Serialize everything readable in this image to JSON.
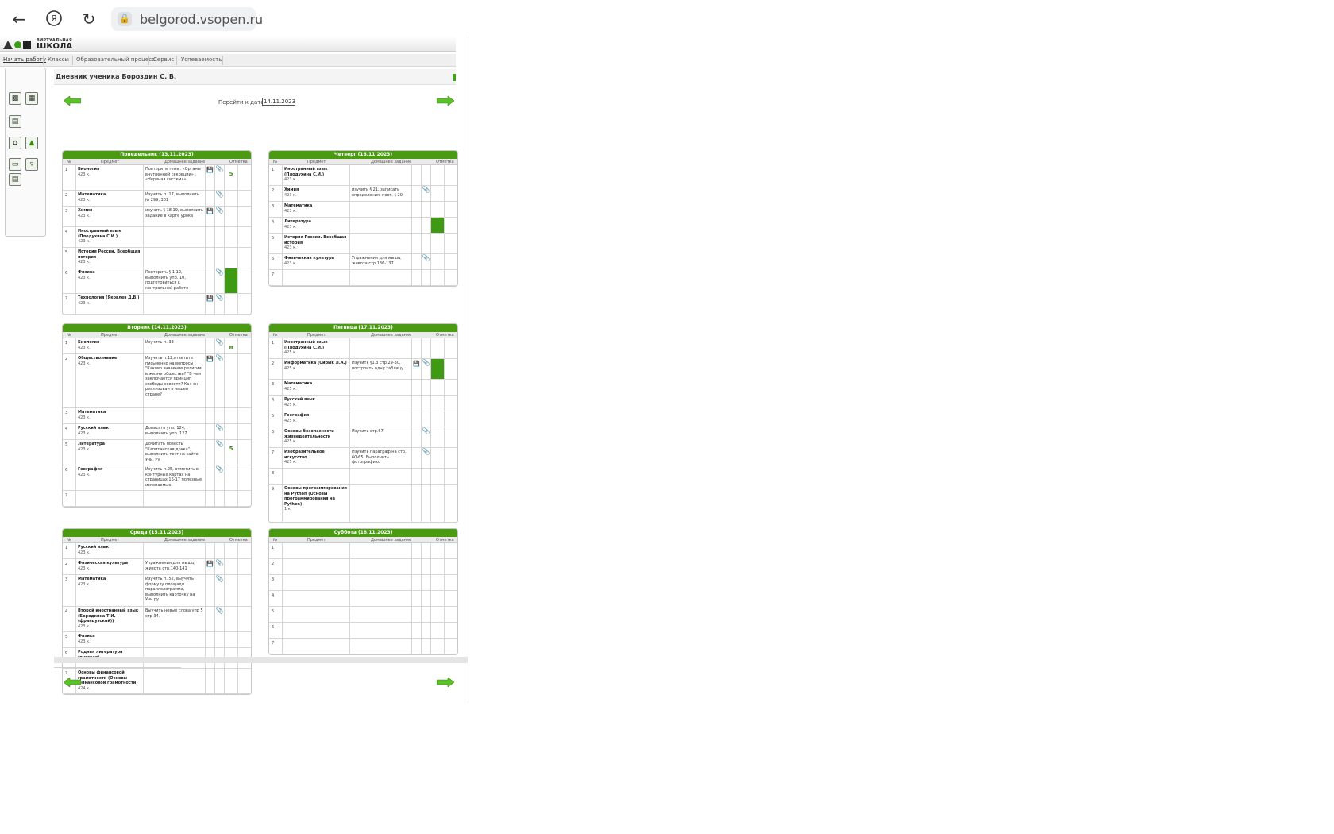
{
  "browser": {
    "url": "belgorod.vsopen.ru"
  },
  "site": {
    "logo_small": "ВИРТУАЛЬНАЯ",
    "logo_big": "ШКОЛА",
    "menu": [
      "Начать работу",
      "Классы",
      "Образовательный процесс",
      "Сервис",
      "Успеваемость"
    ],
    "page_title": "Дневник ученика Бороздин С. В.",
    "date_label": "Перейти к дате:",
    "date_value": "14.11.2023"
  },
  "columns": {
    "num": "№",
    "subject": "Предмет",
    "homework": "Домашнее задание",
    "mark": "Отметка"
  },
  "days": [
    {
      "title": "Понедельник (13.11.2023)",
      "rows": [
        {
          "n": "1",
          "subject": "Биология",
          "room": "423 к.",
          "hw": "Повторить темы: «Органы внутренней секреции» , «Нервная система»",
          "save": true,
          "clip": true,
          "mark": "5",
          "green": false
        },
        {
          "n": "2",
          "subject": "Математика",
          "room": "423 к.",
          "hw": "Изучить п. 17, выполнить № 299, 301",
          "save": false,
          "clip": true,
          "mark": "",
          "green": false
        },
        {
          "n": "3",
          "subject": "Химия",
          "room": "423 к.",
          "hw": "изучить § 18,19, выполнить задание в карте урока",
          "save": true,
          "clip": true,
          "mark": "",
          "green": false
        },
        {
          "n": "4",
          "subject": "Иностранный язык (Плодухина С.И.)",
          "room": "423 к.",
          "hw": "",
          "save": false,
          "clip": false,
          "mark": "",
          "green": false
        },
        {
          "n": "5",
          "subject": "История России. Всеобщая история",
          "room": "423 к.",
          "hw": "",
          "save": false,
          "clip": false,
          "mark": "",
          "green": false
        },
        {
          "n": "6",
          "subject": "Физика",
          "room": "423 к.",
          "hw": "Повторить § 1-12, выполнить упр. 10, подготовиться к контрольной работе",
          "save": false,
          "clip": true,
          "mark": "",
          "green": true
        },
        {
          "n": "7",
          "subject": "Технология (Яковлев Д.В.)",
          "room": "423 к.",
          "hw": "",
          "save": true,
          "clip": true,
          "mark": "",
          "green": false
        }
      ]
    },
    {
      "title": "Четверг (16.11.2023)",
      "rows": [
        {
          "n": "1",
          "subject": "Иностранный язык (Плодухина С.И.)",
          "room": "423 к.",
          "hw": "",
          "save": false,
          "clip": false,
          "mark": "",
          "green": false
        },
        {
          "n": "2",
          "subject": "Химия",
          "room": "423 к.",
          "hw": "изучить § 21, записать определения, повт. § 20",
          "save": false,
          "clip": true,
          "mark": "",
          "green": false
        },
        {
          "n": "3",
          "subject": "Математика",
          "room": "423 к.",
          "hw": "",
          "save": false,
          "clip": false,
          "mark": "",
          "green": false
        },
        {
          "n": "4",
          "subject": "Литература",
          "room": "423 к.",
          "hw": "",
          "save": false,
          "clip": false,
          "mark": "",
          "green": true
        },
        {
          "n": "5",
          "subject": "История России. Всеобщая история",
          "room": "423 к.",
          "hw": "",
          "save": false,
          "clip": false,
          "mark": "",
          "green": false
        },
        {
          "n": "6",
          "subject": "Физическая культура",
          "room": "423 к.",
          "hw": "Упражнения для мышц живота стр.136-137",
          "save": false,
          "clip": true,
          "mark": "",
          "green": false
        },
        {
          "n": "7",
          "subject": "",
          "room": "",
          "hw": "",
          "save": false,
          "clip": false,
          "mark": "",
          "green": false
        }
      ]
    },
    {
      "title": "Вторник (14.11.2023)",
      "rows": [
        {
          "n": "1",
          "subject": "Биология",
          "room": "423 к.",
          "hw": "Изучить п. 33",
          "save": false,
          "clip": true,
          "mark": "н",
          "green": false
        },
        {
          "n": "2",
          "subject": "Обществознание",
          "room": "423 к.",
          "hw": "Изучить п.12,ответить письменно на вопросы : \"Каково значение религии в жизни общества? \"В чем заключается принцип свободы совести? Как он реализован в нашей стране?",
          "save": true,
          "clip": true,
          "mark": "",
          "green": false
        },
        {
          "n": "3",
          "subject": "Математика",
          "room": "423 к.",
          "hw": "",
          "save": false,
          "clip": false,
          "mark": "",
          "green": false
        },
        {
          "n": "4",
          "subject": "Русский язык",
          "room": "423 к.",
          "hw": "Дописать упр. 124, выполнить упр. 127",
          "save": false,
          "clip": true,
          "mark": "",
          "green": false
        },
        {
          "n": "5",
          "subject": "Литература",
          "room": "423 к.",
          "hw": "Дочитать повесть \"Капитанская дочка\", выполнить тест на сайте Учи. Ру",
          "save": false,
          "clip": true,
          "mark": "5",
          "green": false
        },
        {
          "n": "6",
          "subject": "География",
          "room": "423 к.",
          "hw": "Изучить п.25, отметить в контурных картах на страницах 16-17 полезные ископаемые.",
          "save": false,
          "clip": true,
          "mark": "",
          "green": false
        },
        {
          "n": "7",
          "subject": "",
          "room": "",
          "hw": "",
          "save": false,
          "clip": false,
          "mark": "",
          "green": false
        }
      ]
    },
    {
      "title": "Пятница (17.11.2023)",
      "rows": [
        {
          "n": "1",
          "subject": "Иностранный язык (Плодухина С.И.)",
          "room": "425 к.",
          "hw": "",
          "save": false,
          "clip": false,
          "mark": "",
          "green": false
        },
        {
          "n": "2",
          "subject": "Информатика (Сирык Л.А.)",
          "room": "425 к.",
          "hw": "Изучить §1.3 стр 29-30, построить одну таблицу",
          "save": true,
          "clip": true,
          "mark": "",
          "green": true
        },
        {
          "n": "3",
          "subject": "Математика",
          "room": "425 к.",
          "hw": "",
          "save": false,
          "clip": false,
          "mark": "",
          "green": false
        },
        {
          "n": "4",
          "subject": "Русский язык",
          "room": "425 к.",
          "hw": "",
          "save": false,
          "clip": false,
          "mark": "",
          "green": false
        },
        {
          "n": "5",
          "subject": "География",
          "room": "425 к.",
          "hw": "",
          "save": false,
          "clip": false,
          "mark": "",
          "green": false
        },
        {
          "n": "6",
          "subject": "Основы безопасности жизнедеятельности",
          "room": "425 к.",
          "hw": "Изучить стр.67",
          "save": false,
          "clip": true,
          "mark": "",
          "green": false
        },
        {
          "n": "7",
          "subject": "Изобразительное искусство",
          "room": "425 к.",
          "hw": "Изучить параграф на стр. 60-65. Выполнить фотографию.",
          "save": false,
          "clip": true,
          "mark": "",
          "green": false
        },
        {
          "n": "8",
          "subject": "",
          "room": "",
          "hw": "",
          "save": false,
          "clip": false,
          "mark": "",
          "green": false
        },
        {
          "n": "9",
          "subject": "Основы программирования на Python (Основы программирования на Python)",
          "room": "1 к.",
          "hw": "",
          "save": false,
          "clip": false,
          "mark": "",
          "green": false
        }
      ]
    },
    {
      "title": "Среда (15.11.2023)",
      "rows": [
        {
          "n": "1",
          "subject": "Русский язык",
          "room": "423 к.",
          "hw": "",
          "save": false,
          "clip": false,
          "mark": "",
          "green": false
        },
        {
          "n": "2",
          "subject": "Физическая культура",
          "room": "423 к.",
          "hw": "Упражнения для мышц живота стр.140-141",
          "save": true,
          "clip": true,
          "mark": "",
          "green": false
        },
        {
          "n": "3",
          "subject": "Математика",
          "room": "423 к.",
          "hw": "Изучить п. 52, выучить формулу площади параллелограмма, выполнить карточку на Учи.ру",
          "save": false,
          "clip": true,
          "mark": "",
          "green": false
        },
        {
          "n": "4",
          "subject": "Второй иностранный язык (Бородкина Т.И. (французский))",
          "room": "423 к.",
          "hw": "Выучить новые слова упр 5 стр 34.",
          "save": false,
          "clip": true,
          "mark": "",
          "green": false
        },
        {
          "n": "5",
          "subject": "Физика",
          "room": "423 к.",
          "hw": "",
          "save": false,
          "clip": false,
          "mark": "",
          "green": false
        },
        {
          "n": "6",
          "subject": "Родная литература (русская)",
          "room": "423 к.",
          "hw": "",
          "save": false,
          "clip": false,
          "mark": "",
          "green": false
        },
        {
          "n": "7",
          "subject": "Основы финансовой грамотности (Основы финансовой грамотности)",
          "room": "424 к.",
          "hw": "",
          "save": false,
          "clip": false,
          "mark": "",
          "green": false
        }
      ]
    },
    {
      "title": "Суббота (18.11.2023)",
      "rows": [
        {
          "n": "1",
          "subject": "",
          "room": "",
          "hw": "",
          "save": false,
          "clip": false,
          "mark": "",
          "green": false
        },
        {
          "n": "2",
          "subject": "",
          "room": "",
          "hw": "",
          "save": false,
          "clip": false,
          "mark": "",
          "green": false
        },
        {
          "n": "3",
          "subject": "",
          "room": "",
          "hw": "",
          "save": false,
          "clip": false,
          "mark": "",
          "green": false
        },
        {
          "n": "4",
          "subject": "",
          "room": "",
          "hw": "",
          "save": false,
          "clip": false,
          "mark": "",
          "green": false
        },
        {
          "n": "5",
          "subject": "",
          "room": "",
          "hw": "",
          "save": false,
          "clip": false,
          "mark": "",
          "green": false
        },
        {
          "n": "6",
          "subject": "",
          "room": "",
          "hw": "",
          "save": false,
          "clip": false,
          "mark": "",
          "green": false
        },
        {
          "n": "7",
          "subject": "",
          "room": "",
          "hw": "",
          "save": false,
          "clip": false,
          "mark": "",
          "green": false
        }
      ]
    }
  ]
}
